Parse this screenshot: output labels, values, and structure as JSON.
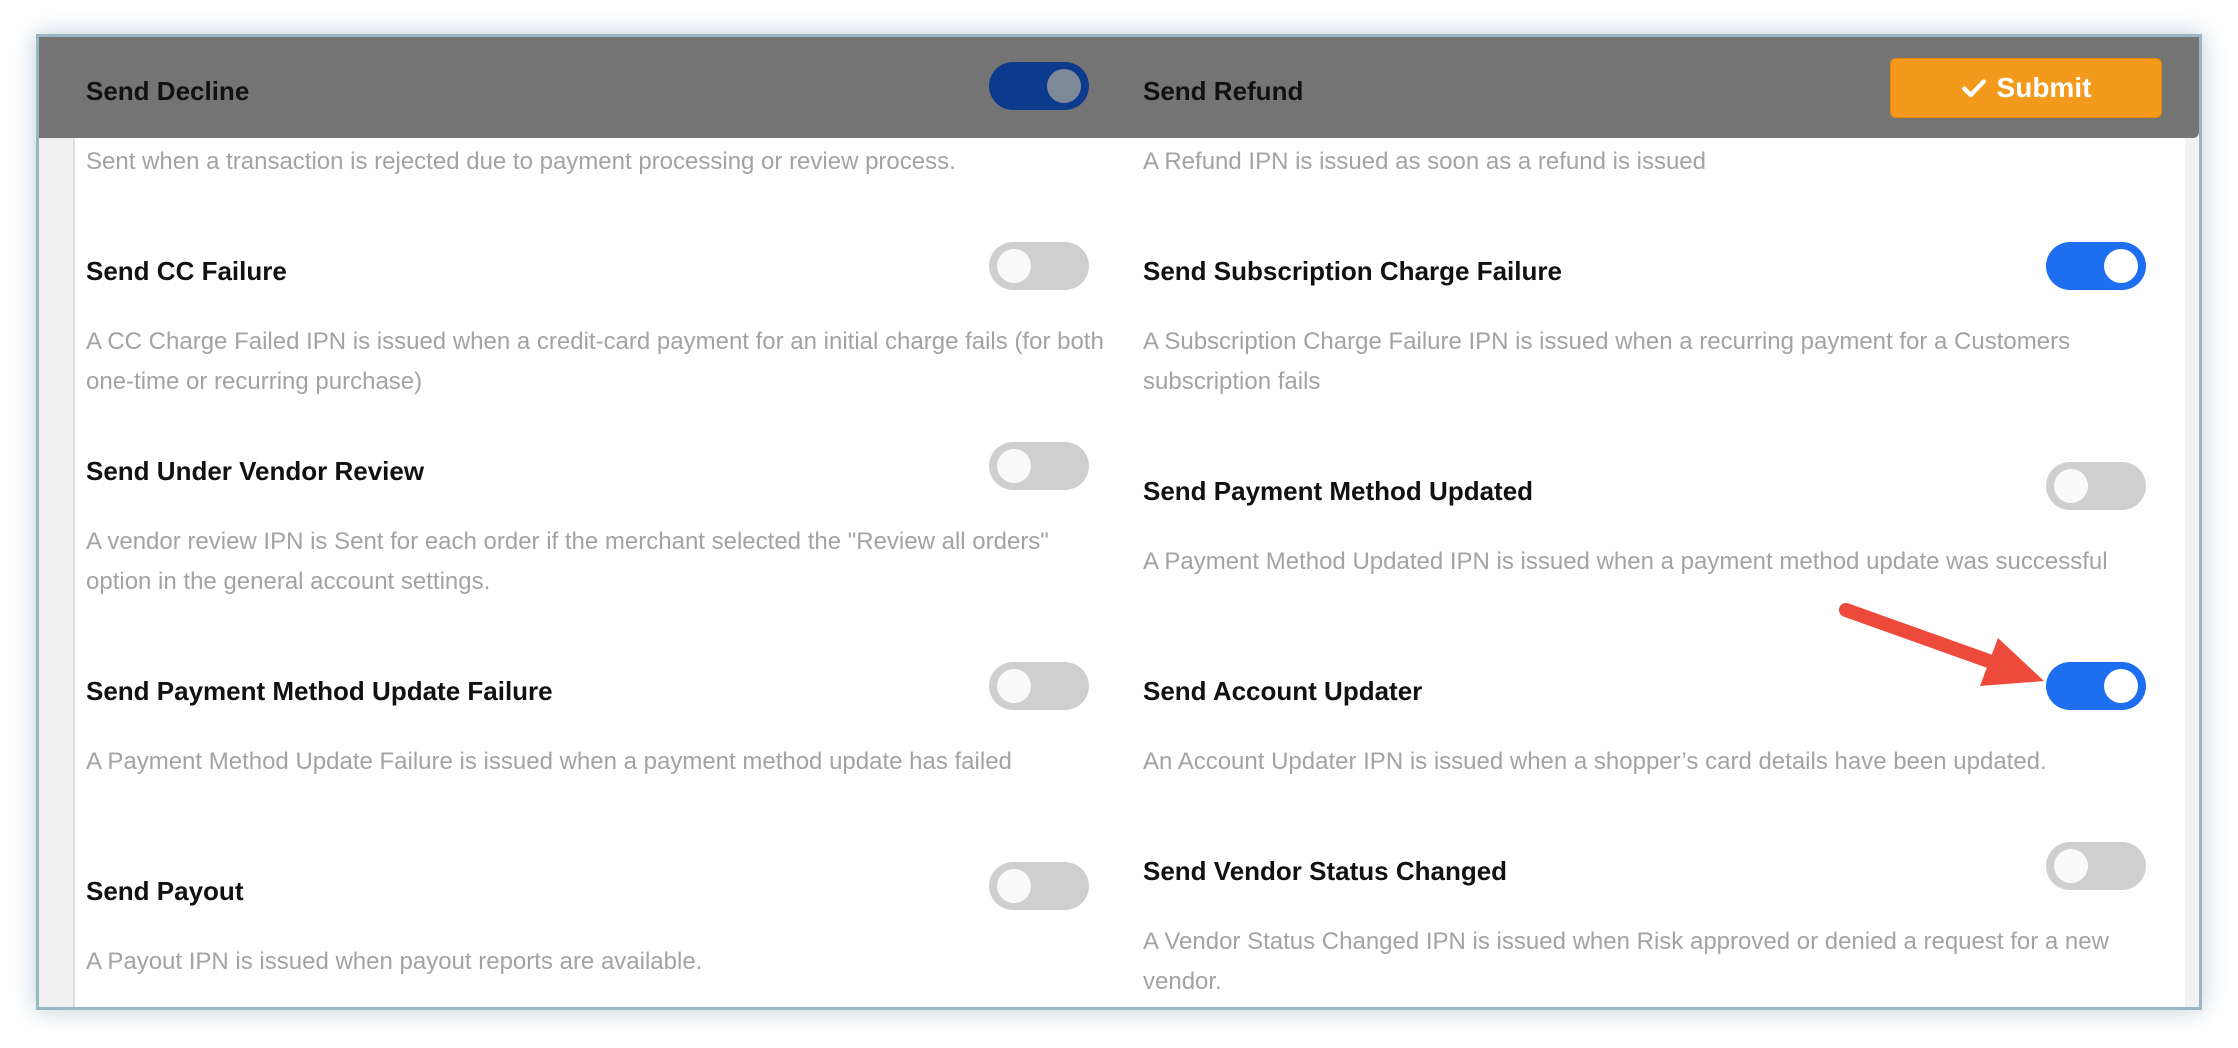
{
  "toolbar": {
    "submit_label": "Submit",
    "submit_icon": "check-icon"
  },
  "colors": {
    "toggle_on": "#1e6ef0",
    "toggle_off": "#cfcfcf",
    "submit": "#f39a1c",
    "arrow": "#ee4a3c"
  },
  "left_items": [
    {
      "title": "Send Decline",
      "desc": "Sent when a transaction is rejected due to payment processing or review process.",
      "enabled": true
    },
    {
      "title": "Send CC Failure",
      "desc": "A CC Charge Failed IPN is issued when a credit-card payment for an initial charge fails (for both one-time or recurring purchase)",
      "enabled": false
    },
    {
      "title": "Send Under Vendor Review",
      "desc": "A vendor review IPN is Sent for each order if the merchant selected the \"Review all orders\" option in the general account settings.",
      "enabled": false
    },
    {
      "title": "Send Payment Method Update Failure",
      "desc": "A Payment Method Update Failure is issued when a payment method update has failed",
      "enabled": false
    },
    {
      "title": "Send Payout",
      "desc": "A Payout IPN is issued when payout reports are available.",
      "enabled": false
    }
  ],
  "right_items": [
    {
      "title": "Send Refund",
      "desc": "A Refund IPN is issued as soon as a refund is issued"
    },
    {
      "title": "Send Subscription Charge Failure",
      "desc": "A Subscription Charge Failure IPN is issued when a recurring payment for a Customers subscription fails",
      "enabled": true
    },
    {
      "title": "Send Payment Method Updated",
      "desc": "A Payment Method Updated IPN is issued when a payment method update was successful",
      "enabled": false
    },
    {
      "title": "Send Account Updater",
      "desc": "An Account Updater IPN is issued when a shopper’s card details have been updated.",
      "enabled": true
    },
    {
      "title": "Send Vendor Status Changed",
      "desc": "A Vendor Status Changed IPN is issued when Risk approved or denied a request for a new vendor.",
      "enabled": false
    }
  ]
}
